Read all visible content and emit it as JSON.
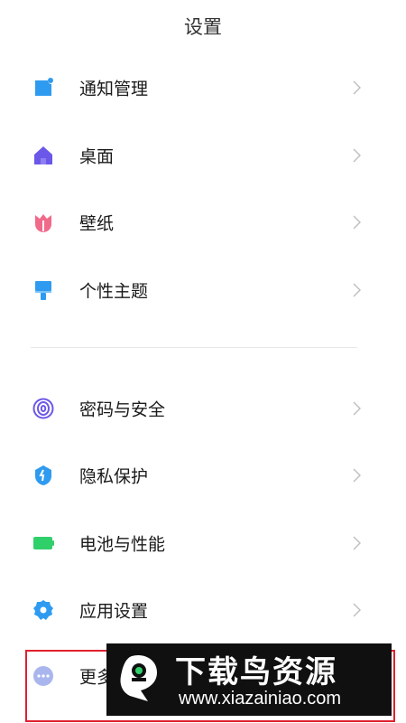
{
  "header": {
    "title": "设置"
  },
  "settings_group_1": [
    {
      "label": "通知管理",
      "icon": "notification-icon"
    },
    {
      "label": "桌面",
      "icon": "home-icon"
    },
    {
      "label": "壁纸",
      "icon": "wallpaper-tulip-icon"
    },
    {
      "label": "个性主题",
      "icon": "theme-brush-icon"
    }
  ],
  "settings_group_2": [
    {
      "label": "密码与安全",
      "icon": "fingerprint-icon"
    },
    {
      "label": "隐私保护",
      "icon": "privacy-shield-icon"
    },
    {
      "label": "电池与性能",
      "icon": "battery-icon"
    },
    {
      "label": "应用设置",
      "icon": "gear-icon"
    },
    {
      "label": "更多",
      "icon": "more-dots-icon"
    }
  ],
  "watermark": {
    "title": "下载鸟资源",
    "url": "www.xiazainiao.com"
  },
  "colors": {
    "notification": "#2f9bf0",
    "home": "#6b57e8",
    "wallpaper": "#f06a8a",
    "theme": "#2f9bf0",
    "fingerprint": "#6b57e8",
    "privacy": "#2f9bf0",
    "battery": "#2fcf6a",
    "gear": "#2f9bf0",
    "more": "#a9b6ee",
    "highlight": "#e0202f",
    "watermark_bg": "#101010"
  }
}
